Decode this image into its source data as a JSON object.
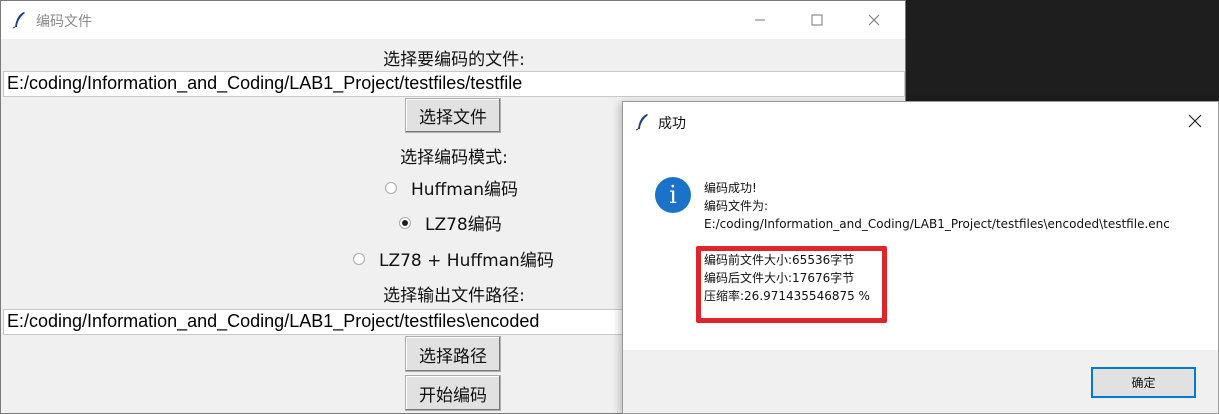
{
  "main_window": {
    "title": "编码文件",
    "select_file_label": "选择要编码的文件:",
    "input_path": "E:/coding/Information_and_Coding/LAB1_Project/testfiles/testfile",
    "select_file_button": "选择文件",
    "mode_label": "选择编码模式:",
    "modes": [
      {
        "label": "Huffman编码",
        "selected": false
      },
      {
        "label": "LZ78编码",
        "selected": true
      },
      {
        "label": "LZ78 + Huffman编码",
        "selected": false
      }
    ],
    "output_label": "选择输出文件路径:",
    "output_path": "E:/coding/Information_and_Coding/LAB1_Project/testfiles\\encoded",
    "select_path_button": "选择路径",
    "start_button": "开始编码"
  },
  "dialog": {
    "title": "成功",
    "icon": "info-icon",
    "icon_char": "i",
    "lines": [
      "编码成功!",
      "编码文件为:",
      "E:/coding/Information_and_Coding/LAB1_Project/testfiles\\encoded\\testfile.enc",
      "编码前文件大小:65536字节",
      "编码后文件大小:17676字节",
      "压缩率:26.971435546875 %"
    ],
    "ok_button": "确定"
  },
  "colors": {
    "highlight": "#e0242b",
    "info_icon": "#1a73c9",
    "focus_border": "#0078d7"
  }
}
